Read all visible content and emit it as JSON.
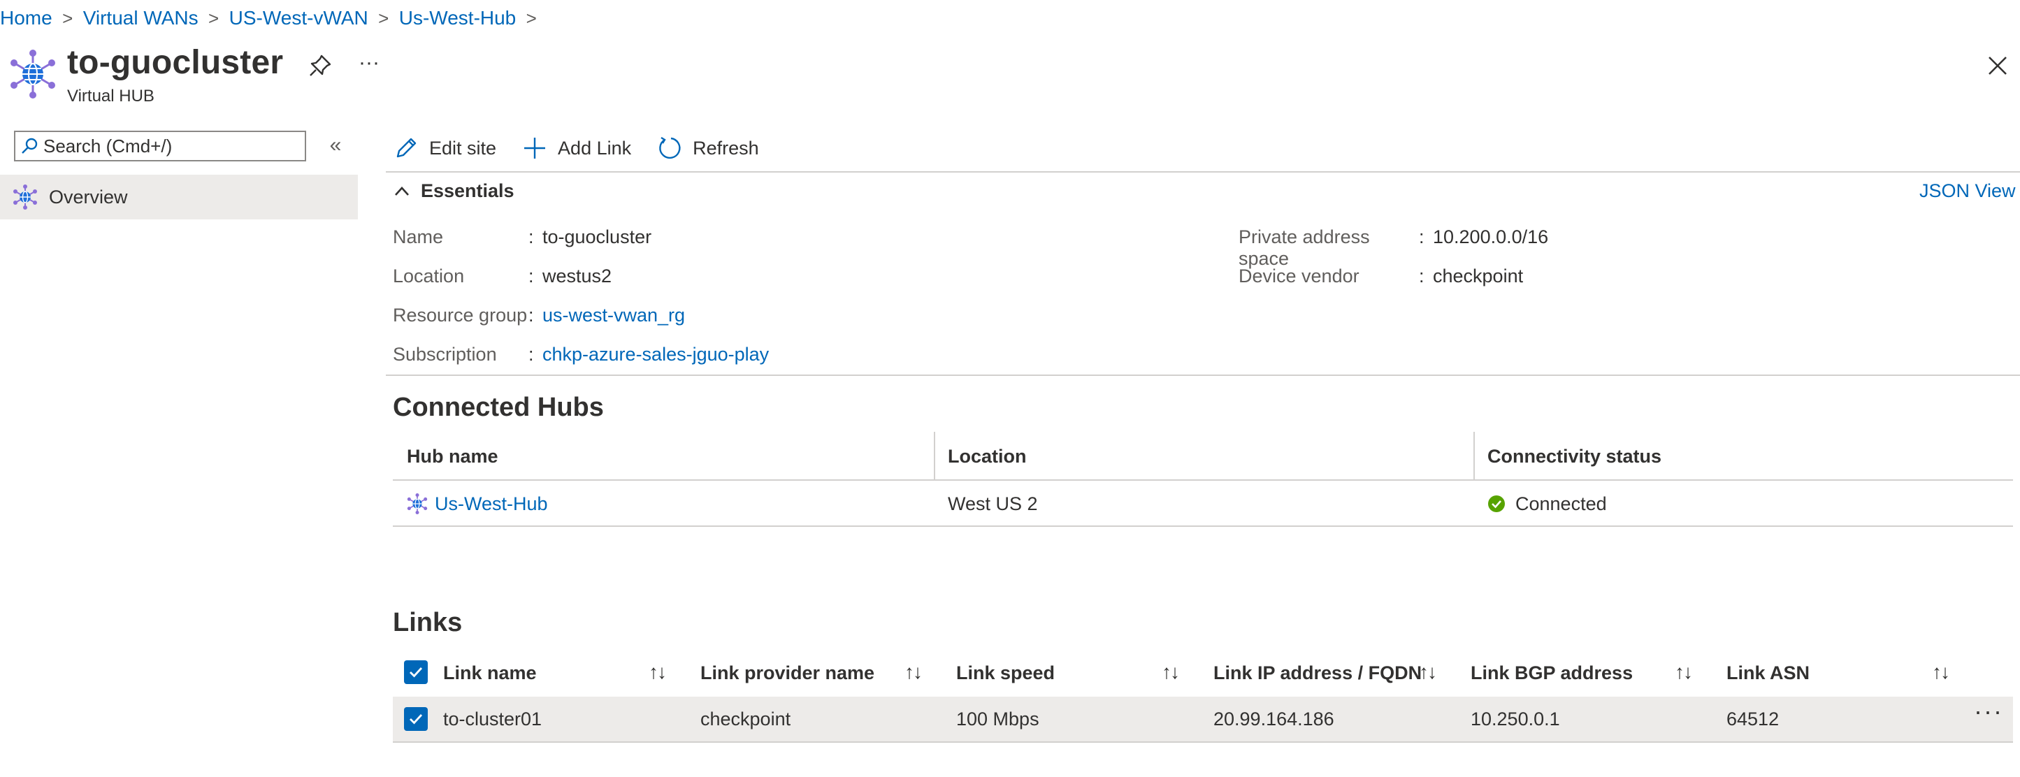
{
  "breadcrumb": [
    {
      "label": "Home"
    },
    {
      "label": "Virtual WANs"
    },
    {
      "label": "US-West-vWAN"
    },
    {
      "label": "Us-West-Hub"
    }
  ],
  "header": {
    "title": "to-guocluster",
    "subtitle": "Virtual HUB",
    "more_label": "···"
  },
  "sidebar": {
    "search_placeholder": "Search (Cmd+/)",
    "collapse_label": "«",
    "items": [
      {
        "label": "Overview",
        "selected": true
      }
    ]
  },
  "toolbar": {
    "edit_label": "Edit site",
    "add_label": "Add Link",
    "refresh_label": "Refresh"
  },
  "essentials": {
    "title": "Essentials",
    "json_view": "JSON View",
    "left": [
      {
        "key": "Name",
        "value": "to-guocluster",
        "link": false
      },
      {
        "key": "Location",
        "value": "westus2",
        "link": false
      },
      {
        "key": "Resource group",
        "value": "us-west-vwan_rg",
        "link": true
      },
      {
        "key": "Subscription",
        "value": "chkp-azure-sales-jguo-play",
        "link": true
      }
    ],
    "right": [
      {
        "key": "Private address space",
        "value": "10.200.0.0/16",
        "link": false
      },
      {
        "key": "Device vendor",
        "value": "checkpoint",
        "link": false
      }
    ],
    "separator": ":"
  },
  "connected_hubs": {
    "title": "Connected Hubs",
    "columns": [
      "Hub name",
      "Location",
      "Connectivity status"
    ],
    "rows": [
      {
        "hub_name": "Us-West-Hub",
        "location": "West US 2",
        "status": "Connected"
      }
    ]
  },
  "links": {
    "title": "Links",
    "columns": [
      "Link name",
      "Link provider name",
      "Link speed",
      "Link IP address / FQDN",
      "Link BGP address",
      "Link ASN"
    ],
    "sort_glyph": "↑↓",
    "rows": [
      {
        "name": "to-cluster01",
        "provider": "checkpoint",
        "speed": "100 Mbps",
        "ip": "20.99.164.186",
        "bgp": "10.250.0.1",
        "asn": "64512",
        "checked": true
      }
    ],
    "row_more": "···"
  },
  "colors": {
    "link": "#0067b8",
    "accent": "#0067b8",
    "success": "#57a300",
    "selected_bg": "#edebe9",
    "hub_icon": "#5c5fd6"
  },
  "icons": [
    "virtual-hub-icon",
    "pin-icon",
    "close-icon",
    "search-icon",
    "edit-icon",
    "add-icon",
    "refresh-icon",
    "chevron-up-icon",
    "checkmark-icon",
    "status-connected-icon"
  ]
}
